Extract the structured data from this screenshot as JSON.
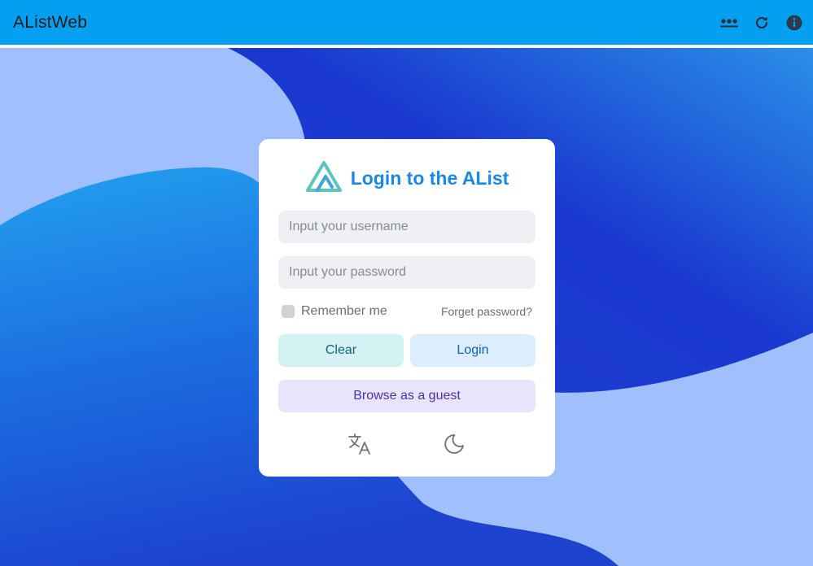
{
  "app": {
    "title": "AListWeb"
  },
  "header_icons": [
    {
      "name": "more-icon"
    },
    {
      "name": "refresh-icon"
    },
    {
      "name": "info-icon"
    }
  ],
  "login": {
    "title": "Login to the AList",
    "username_placeholder": "Input your username",
    "password_placeholder": "Input your password",
    "remember_label": "Remember me",
    "remember_checked": false,
    "forget_label": "Forget password?",
    "clear_label": "Clear",
    "login_label": "Login",
    "guest_label": "Browse as a guest",
    "bottom_icons": [
      {
        "name": "translate-icon"
      },
      {
        "name": "moon-icon"
      }
    ]
  },
  "colors": {
    "header": "#03a0f1",
    "title_accent": "#1a89e3",
    "logo": "#5ec4c0",
    "background_light": "#a1bffd",
    "background_deep": "#1a2fd0"
  }
}
